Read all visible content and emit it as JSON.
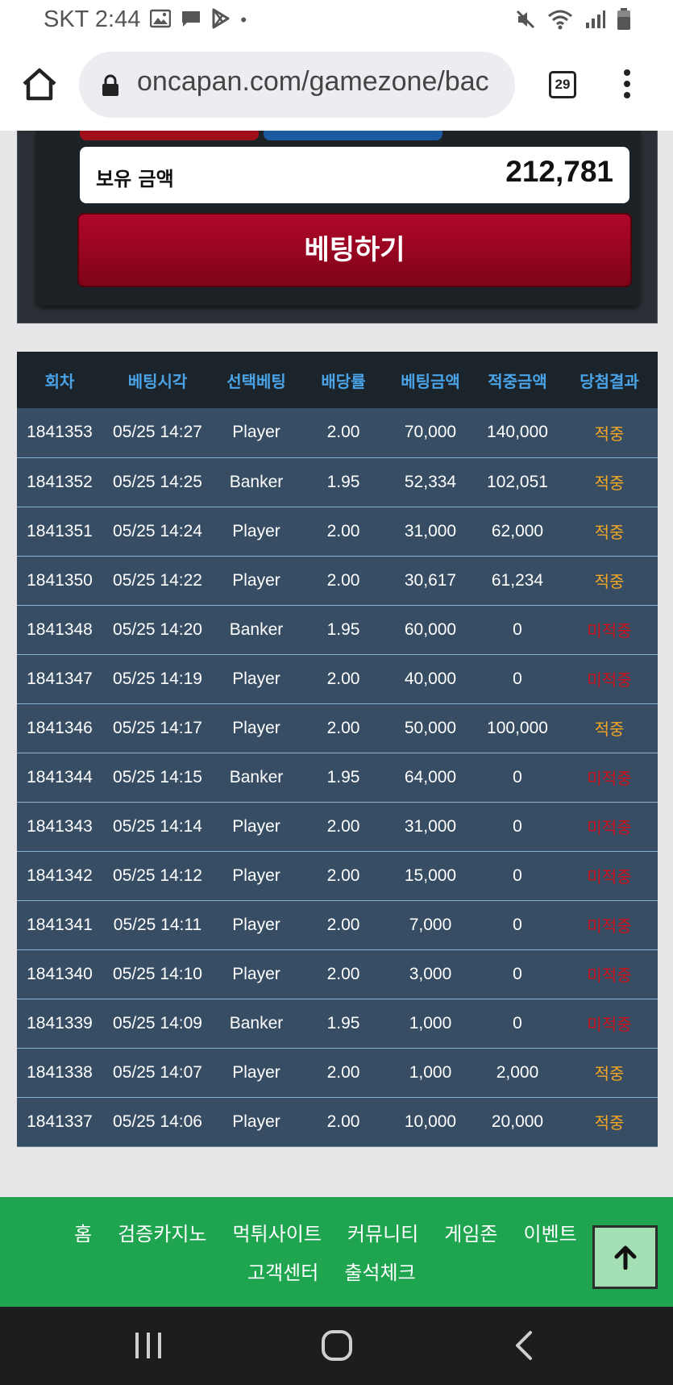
{
  "status_bar": {
    "carrier_time": "SKT 2:44",
    "dot": "•",
    "icons": [
      "image-icon",
      "message-icon",
      "play-store-icon",
      "mute-icon",
      "wifi-icon",
      "signal-icon",
      "battery-icon"
    ]
  },
  "browser": {
    "url": "oncapan.com/gamezone/bac",
    "tab_count": "29",
    "icons": [
      "home-icon",
      "lock-icon",
      "more-vert-icon"
    ]
  },
  "betting_panel": {
    "balance_label": "보유 금액",
    "balance_value": "212,781",
    "bet_button_label": "베팅하기",
    "colors": {
      "button": "#9c0622",
      "panel": "#1d2226"
    }
  },
  "table": {
    "headers": [
      "회차",
      "베팅시각",
      "선택베팅",
      "배당률",
      "베팅금액",
      "적중금액",
      "당첨결과"
    ],
    "rows": [
      [
        "1841353",
        "05/25 14:27",
        "Player",
        "2.00",
        "70,000",
        "140,000",
        "적중"
      ],
      [
        "1841352",
        "05/25 14:25",
        "Banker",
        "1.95",
        "52,334",
        "102,051",
        "적중"
      ],
      [
        "1841351",
        "05/25 14:24",
        "Player",
        "2.00",
        "31,000",
        "62,000",
        "적중"
      ],
      [
        "1841350",
        "05/25 14:22",
        "Player",
        "2.00",
        "30,617",
        "61,234",
        "적중"
      ],
      [
        "1841348",
        "05/25 14:20",
        "Banker",
        "1.95",
        "60,000",
        "0",
        "미적중"
      ],
      [
        "1841347",
        "05/25 14:19",
        "Player",
        "2.00",
        "40,000",
        "0",
        "미적중"
      ],
      [
        "1841346",
        "05/25 14:17",
        "Player",
        "2.00",
        "50,000",
        "100,000",
        "적중"
      ],
      [
        "1841344",
        "05/25 14:15",
        "Banker",
        "1.95",
        "64,000",
        "0",
        "미적중"
      ],
      [
        "1841343",
        "05/25 14:14",
        "Player",
        "2.00",
        "31,000",
        "0",
        "미적중"
      ],
      [
        "1841342",
        "05/25 14:12",
        "Player",
        "2.00",
        "15,000",
        "0",
        "미적중"
      ],
      [
        "1841341",
        "05/25 14:11",
        "Player",
        "2.00",
        "7,000",
        "0",
        "미적중"
      ],
      [
        "1841340",
        "05/25 14:10",
        "Player",
        "2.00",
        "3,000",
        "0",
        "미적중"
      ],
      [
        "1841339",
        "05/25 14:09",
        "Banker",
        "1.95",
        "1,000",
        "0",
        "미적중"
      ],
      [
        "1841338",
        "05/25 14:07",
        "Player",
        "2.00",
        "1,000",
        "2,000",
        "적중"
      ],
      [
        "1841337",
        "05/25 14:06",
        "Player",
        "2.00",
        "10,000",
        "20,000",
        "적중"
      ]
    ],
    "colors": {
      "hit": "#f5a623",
      "miss": "#d0101a",
      "header_text": "#4aa3e6"
    }
  },
  "footer": {
    "links_row1": [
      "홈",
      "검증카지노",
      "먹튀사이트",
      "커뮤니티",
      "게임존",
      "이벤트"
    ],
    "links_row2": [
      "고객센터",
      "출석체크"
    ],
    "color": "#1fa44f"
  },
  "scroll_top_icon": "arrow-up-icon",
  "nav_bar": {
    "icons": [
      "recent-apps-icon",
      "home-nav-icon",
      "back-icon"
    ]
  }
}
